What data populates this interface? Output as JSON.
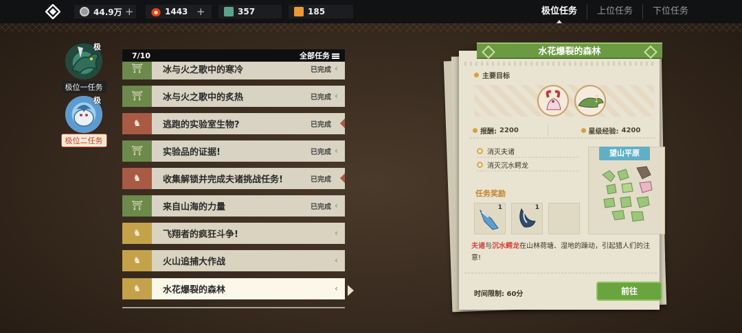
{
  "topbar": {
    "resources": [
      {
        "icon": "coin-icon",
        "value": "44.9万",
        "has_plus": true
      },
      {
        "icon": "flame-icon",
        "value": "1443",
        "has_plus": true
      },
      {
        "icon": "ticket-icon",
        "value": "357",
        "has_plus": false
      },
      {
        "icon": "scroll-icon",
        "value": "185",
        "has_plus": false
      }
    ],
    "tabs": [
      "极位任务",
      "上位任务",
      "下位任务"
    ],
    "active_tab": 0
  },
  "ranks": [
    {
      "label": "极位一任务",
      "badge": "极"
    },
    {
      "label": "极位二任务",
      "badge": "极"
    }
  ],
  "quest_list": {
    "progress": "7/10",
    "filter_label": "全部任务",
    "items": [
      {
        "name": "冰与火之歌中的寒冷",
        "status": "已完成",
        "kind": "green"
      },
      {
        "name": "冰与火之歌中的炙热",
        "status": "已完成",
        "kind": "green"
      },
      {
        "name": "逃跑的实验室生物?",
        "status": "已完成",
        "kind": "red"
      },
      {
        "name": "实验品的证据!",
        "status": "已完成",
        "kind": "green"
      },
      {
        "name": "收集解锁并完成夫诸挑战任务!",
        "status": "已完成",
        "kind": "red"
      },
      {
        "name": "来自山海的力量",
        "status": "已完成",
        "kind": "green"
      },
      {
        "name": "飞翔者的疯狂斗争!",
        "status": "",
        "kind": "gold"
      },
      {
        "name": "火山追捕大作战",
        "status": "",
        "kind": "gold"
      },
      {
        "name": "水花爆裂的森林",
        "status": "",
        "kind": "gold",
        "selected": true
      }
    ]
  },
  "detail": {
    "title": "水花爆裂的森林",
    "main_target_label": "主要目标",
    "reward_label": "报酬:",
    "reward_value": "2200",
    "exp_label": "星级经验:",
    "exp_value": "4200",
    "objectives": [
      "消灭夫诸",
      "消灭沉水鳄龙"
    ],
    "map_name": "望山平原",
    "task_reward_label": "任务奖励",
    "reward_items": [
      {
        "icon": "claw-item-icon",
        "count": "1"
      },
      {
        "icon": "fang-item-icon",
        "count": "1"
      },
      {
        "icon": "empty-slot",
        "count": ""
      }
    ],
    "description": {
      "monster1": "夫诸",
      "join": "与",
      "monster2": "沉水鳄龙",
      "rest": "在山林荷塘、湿地的躁动，引起猎人们的注意!"
    },
    "time_limit": "时间限制: 60分",
    "go_button": "前往"
  },
  "colors": {
    "green_cap": "#6c8a4c",
    "red_cap": "#a85a45",
    "gold_cap": "#c4a24a",
    "title_green": "#6c9a42",
    "map_title_blue": "#5fb0c6",
    "highlight_red": "#d3423a"
  }
}
